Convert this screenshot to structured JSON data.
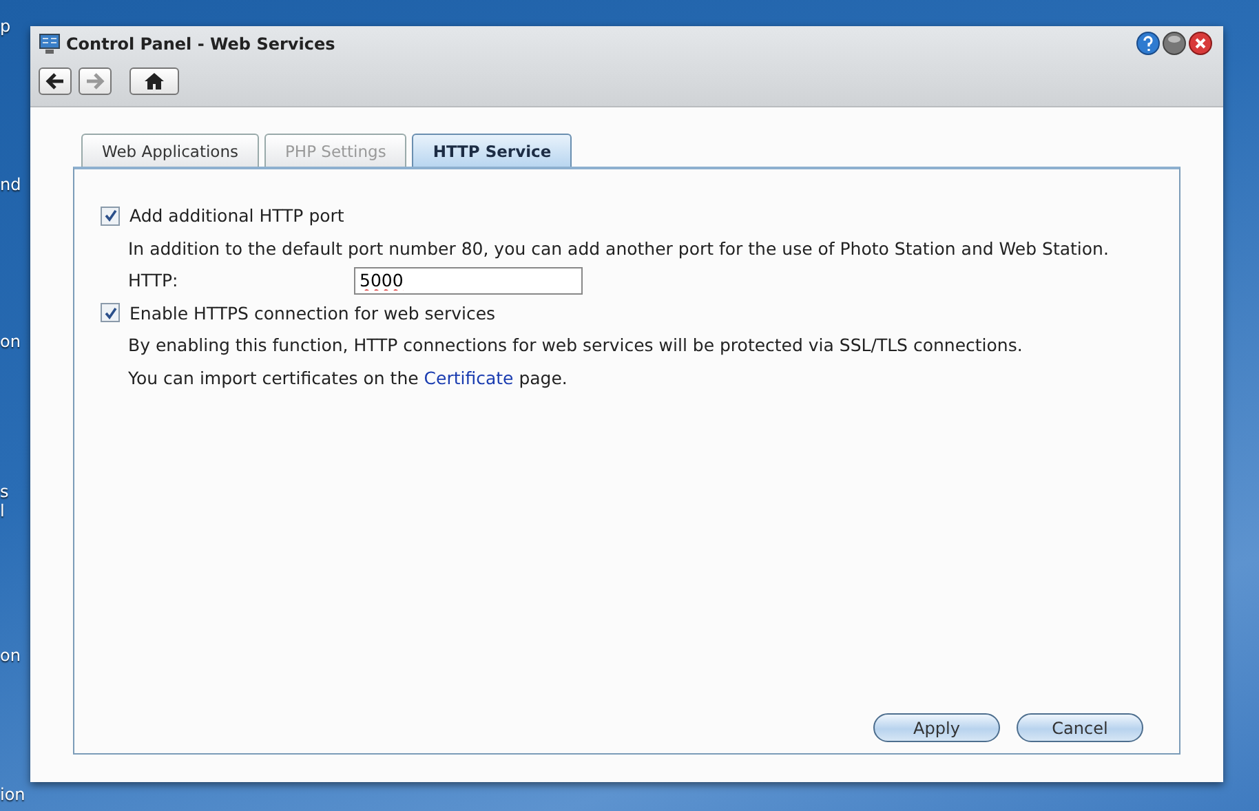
{
  "desktop_labels": [
    "p",
    "nd",
    "on",
    "s",
    "l",
    "on",
    "ion"
  ],
  "window": {
    "title": "Control Panel - Web Services"
  },
  "toolbar": [
    {
      "kind": "back",
      "disabled": false
    },
    {
      "kind": "forward",
      "disabled": true
    },
    {
      "kind": "home",
      "disabled": false
    }
  ],
  "tabs": [
    {
      "label": "Web Applications",
      "selected": false,
      "disabled": false
    },
    {
      "label": "PHP Settings",
      "selected": false,
      "disabled": true
    },
    {
      "label": "HTTP Service",
      "selected": true,
      "disabled": false
    }
  ],
  "settings": [
    {
      "kind": "checkbox",
      "label": "Add additional HTTP port",
      "checked": true
    },
    {
      "kind": "text",
      "text": "In addition to the default port number 80, you can add another port for the use of Photo Station and Web Station."
    },
    {
      "kind": "field",
      "label": "HTTP:",
      "value": "5000"
    },
    {
      "kind": "checkbox",
      "label": "Enable HTTPS connection for web services",
      "checked": true
    },
    {
      "kind": "text",
      "text": "By enabling this function, HTTP connections for web services will be protected via SSL/TLS connections."
    },
    {
      "kind": "link_text",
      "before": "You can import certificates on the ",
      "link": "Certificate",
      "after": " page."
    }
  ],
  "buttons": [
    "Apply",
    "Cancel"
  ]
}
